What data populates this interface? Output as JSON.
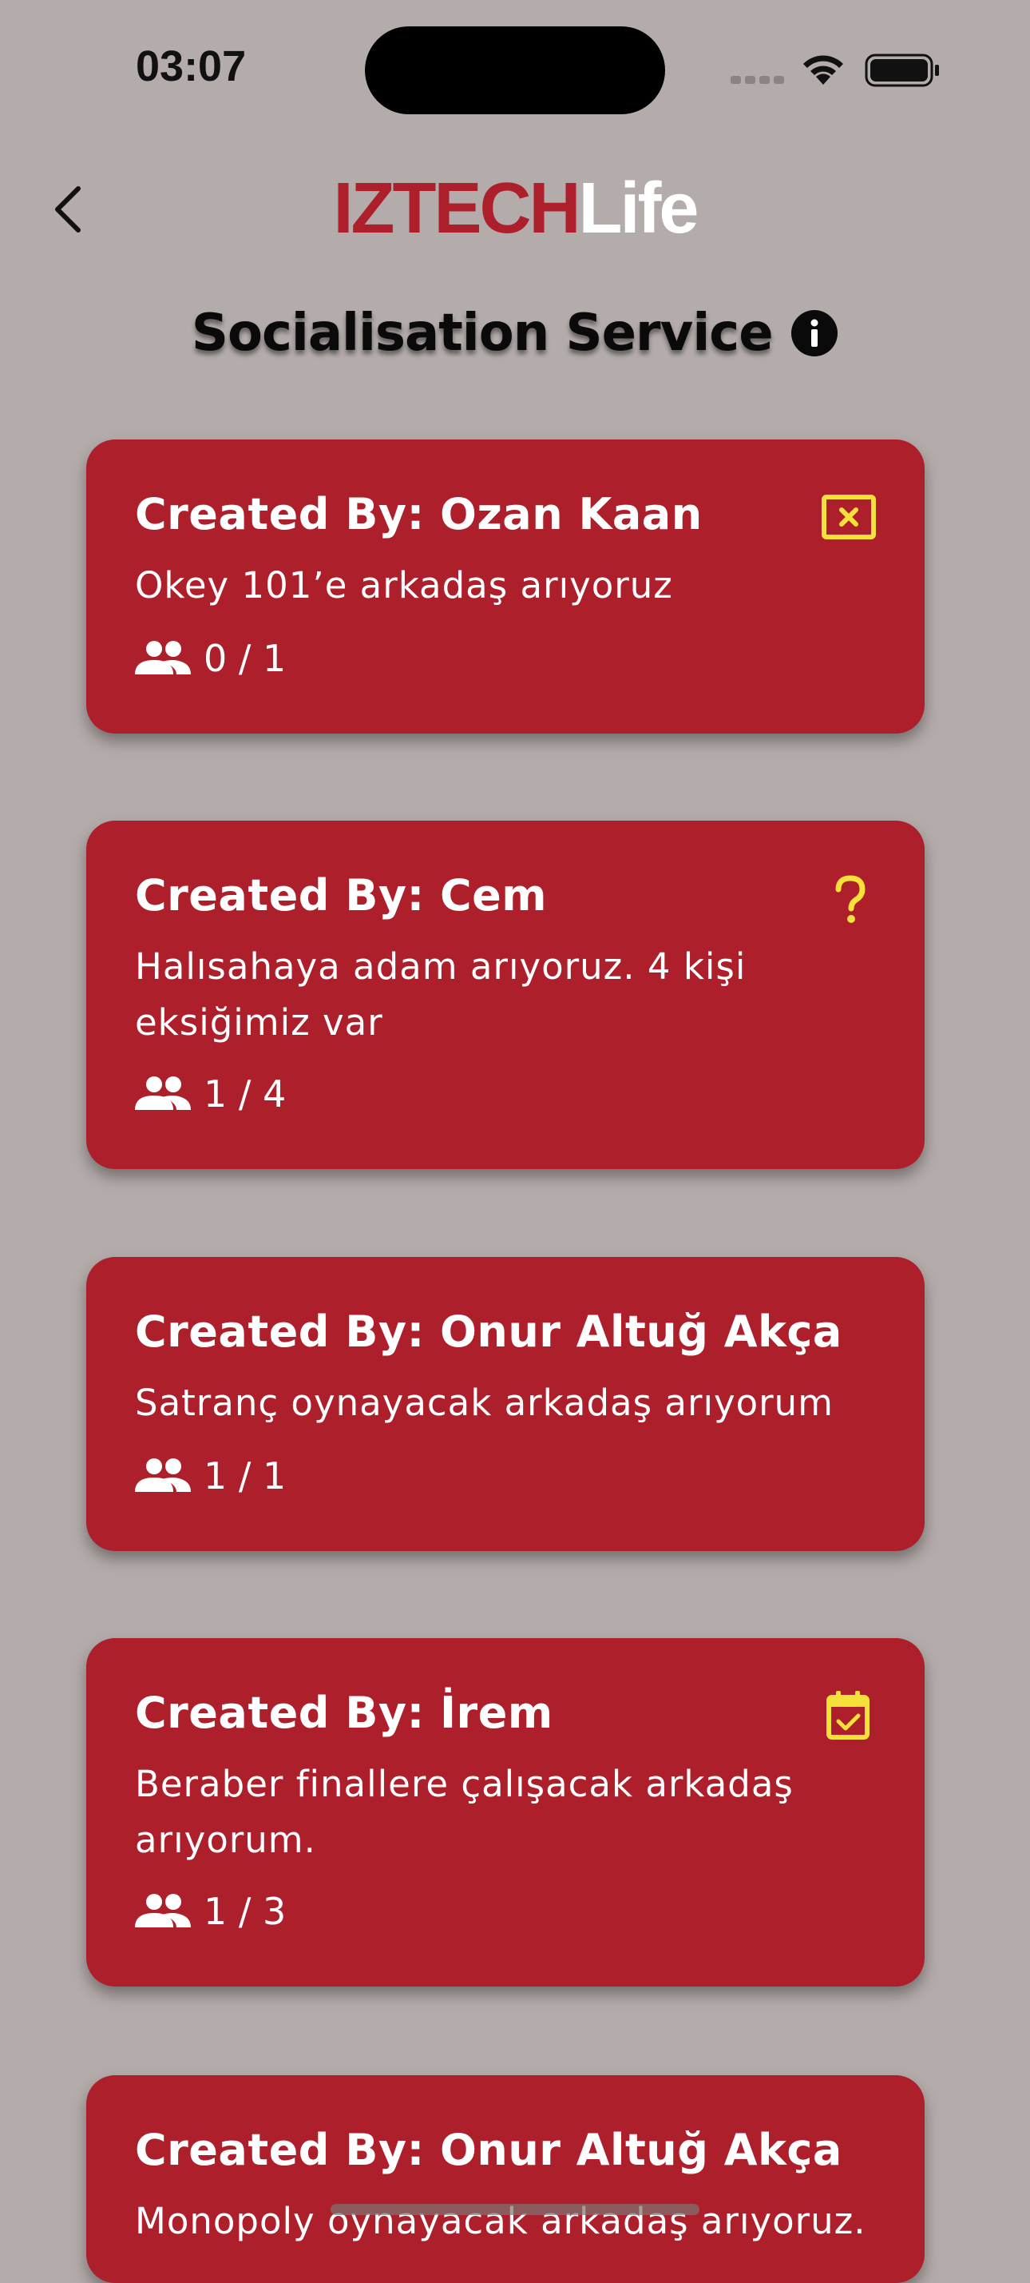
{
  "status_bar": {
    "time": "03:07"
  },
  "header": {
    "brand_part1": "IZTECH",
    "brand_part2": "Life",
    "title": "Socialisation Service"
  },
  "posts": [
    {
      "title": "Created By: Ozan Kaan",
      "description": "Okey 101’e  arkadaş arıyoruz",
      "count": "0 / 1",
      "status_icon": "close-box-icon"
    },
    {
      "title": "Created By: Cem",
      "description": "Halısahaya adam arıyoruz. 4 kişi eksiğimiz var",
      "count": "1 / 4",
      "status_icon": "question-icon"
    },
    {
      "title": "Created By: Onur Altuğ Akça",
      "description": "Satranç oynayacak arkadaş arıyorum",
      "count": "1 / 1",
      "status_icon": ""
    },
    {
      "title": "Created By: İrem",
      "description": "Beraber finallere çalışacak arkadaş arıyorum.",
      "count": "1 / 3",
      "status_icon": "calendar-check-icon"
    },
    {
      "title": "Created By: Onur Altuğ Akça",
      "description": "Monopoly oynayacak arkadaş arıyoruz.",
      "count": "",
      "status_icon": ""
    }
  ],
  "colors": {
    "accent": "#ad1f2a",
    "background": "#b4acab",
    "status_icon": "#f5e13a"
  }
}
